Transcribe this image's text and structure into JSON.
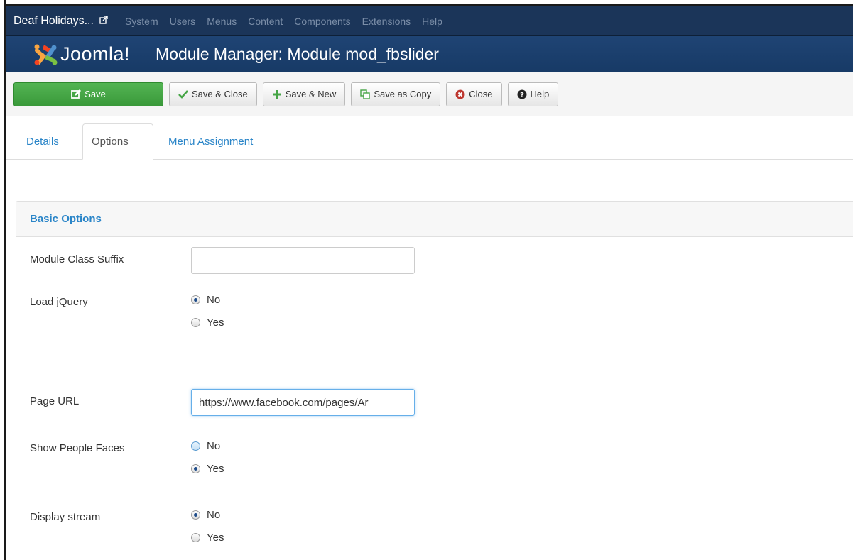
{
  "navbar": {
    "site_name": "Deaf Holidays...",
    "items": [
      "System",
      "Users",
      "Menus",
      "Content",
      "Components",
      "Extensions",
      "Help"
    ]
  },
  "header": {
    "logo_text": "Joomla!",
    "title": "Module Manager: Module mod_fbslider"
  },
  "toolbar": {
    "save": "Save",
    "save_close": "Save & Close",
    "save_new": "Save & New",
    "save_copy": "Save as Copy",
    "close": "Close",
    "help": "Help"
  },
  "tabs": [
    "Details",
    "Options",
    "Menu Assignment"
  ],
  "active_tab": "Options",
  "panel": {
    "heading": "Basic Options",
    "fields": {
      "module_class_suffix": {
        "label": "Module Class Suffix",
        "value": ""
      },
      "load_jquery": {
        "label": "Load jQuery",
        "options": [
          "No",
          "Yes"
        ],
        "selected": "No"
      },
      "page_url": {
        "label": "Page URL",
        "value": "https://www.facebook.com/pages/Ar"
      },
      "show_faces": {
        "label": "Show People Faces",
        "options": [
          "No",
          "Yes"
        ],
        "selected": "Yes"
      },
      "display_stream": {
        "label": "Display stream",
        "options": [
          "No",
          "Yes"
        ],
        "selected": "No"
      }
    }
  },
  "colors": {
    "navbar_bg": "#1b3559",
    "header_bg": "#1f4474",
    "save_green": "#46a546",
    "link_blue": "#2a85c8"
  }
}
